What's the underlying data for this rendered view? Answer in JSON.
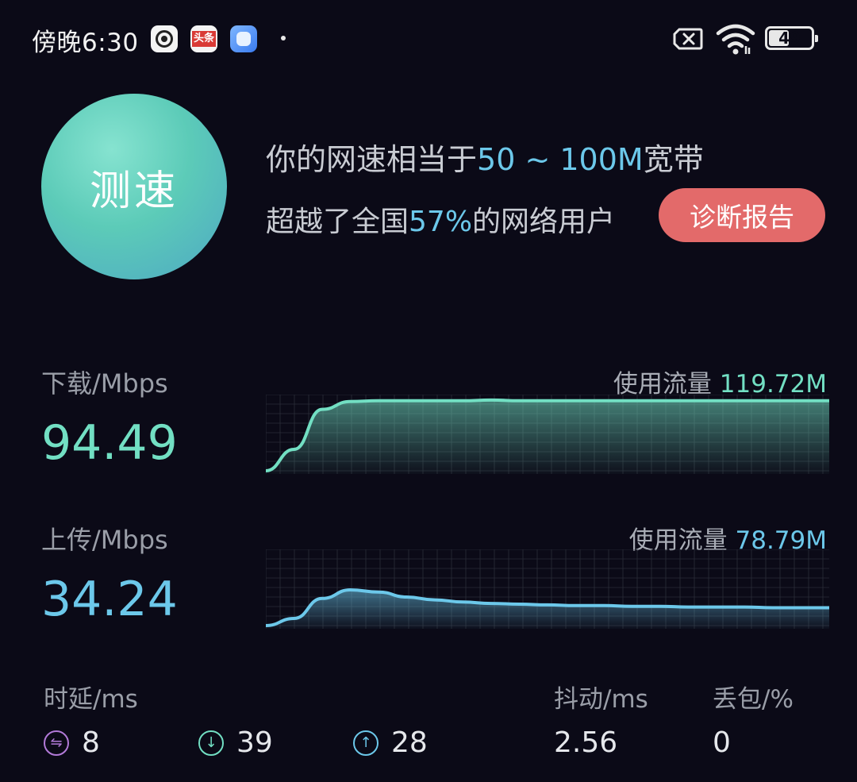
{
  "status_bar": {
    "time": "傍晚6:30",
    "app_icon_2_text": "头条",
    "battery_percent": "49",
    "icons": [
      "camera-app-icon",
      "toutiao-app-icon",
      "blue-app-icon",
      "notification-dot-icon",
      "sim-off-icon",
      "wifi-icon",
      "battery-icon"
    ]
  },
  "speed_button": {
    "label": "测速"
  },
  "summary": {
    "line1_prefix": "你的网速相当于",
    "line1_highlight": "50 ~ 100M",
    "line1_suffix": "宽带",
    "line2_prefix": "超越了全国",
    "line2_highlight": "57%",
    "line2_suffix": "的网络用户"
  },
  "report_button": {
    "label": "诊断报告"
  },
  "download": {
    "label": "下载/Mbps",
    "value": "94.49",
    "usage_label": "使用流量",
    "usage_value": "119.72M",
    "color": "#72dfc3",
    "curve": [
      0,
      0.3,
      0.86,
      0.97,
      0.98,
      0.98,
      0.98,
      0.98,
      0.99,
      0.98,
      0.98,
      0.98,
      0.98,
      0.98,
      0.98,
      0.98,
      0.98,
      0.98,
      0.98,
      0.98,
      0.98
    ]
  },
  "upload": {
    "label": "上传/Mbps",
    "value": "34.24",
    "usage_label": "使用流量",
    "usage_value": "78.79M",
    "color": "#6cc8ea",
    "curve": [
      0,
      0.1,
      0.38,
      0.5,
      0.47,
      0.4,
      0.36,
      0.33,
      0.31,
      0.3,
      0.29,
      0.28,
      0.28,
      0.27,
      0.27,
      0.26,
      0.26,
      0.26,
      0.25,
      0.25,
      0.25
    ]
  },
  "stats": {
    "latency_label": "时延/ms",
    "latency_idle": "8",
    "latency_down": "39",
    "latency_up": "28",
    "jitter_label": "抖动/ms",
    "jitter_value": "2.56",
    "loss_label": "丢包/%",
    "loss_value": "0",
    "icon_colors": {
      "idle": "#b27ad8",
      "down": "#72dfc3",
      "up": "#6cc8ea"
    }
  }
}
